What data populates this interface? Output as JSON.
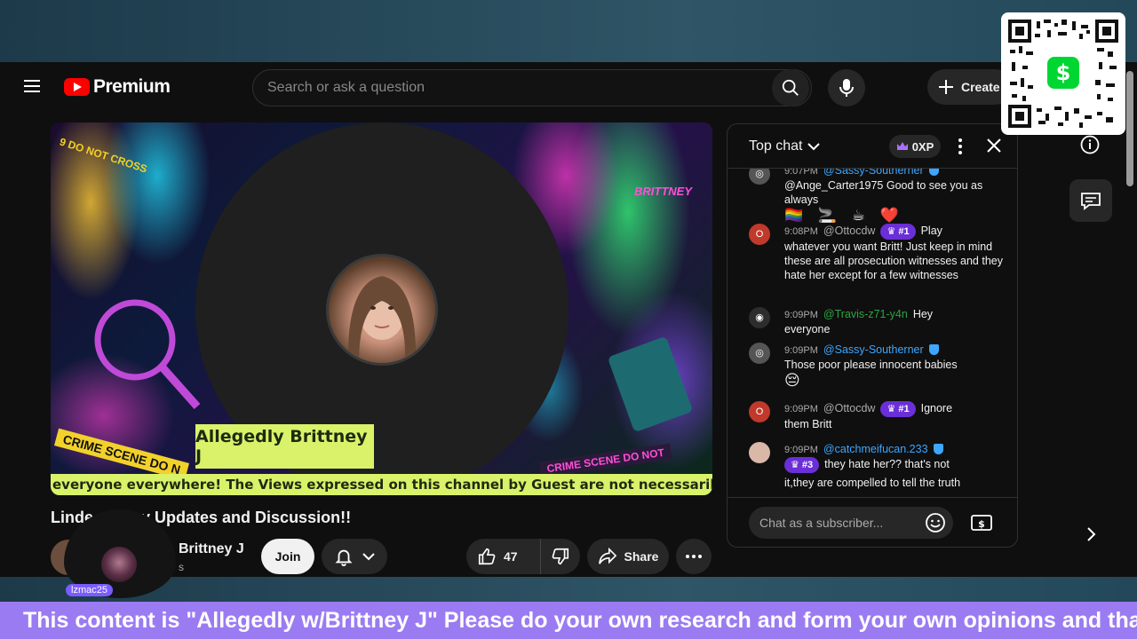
{
  "app": {
    "logo_text": "Premium",
    "search_placeholder": "Search or ask a question",
    "create_label": "Create"
  },
  "video": {
    "overlay_name": "Allegedly Brittney J",
    "ticker_text": "everyone everywhere! The Views expressed on this channel by Guest are not necessarily the views o",
    "brand_tag": "BRITTNEY",
    "tape_top": "9 DO NOT CROSS",
    "tape_bottom_left": "CRIME SCENE DO N",
    "tape_bottom_right": "CRIME SCENE DO NOT"
  },
  "watch": {
    "title": "Linda McNancy Updates and Discussion!!",
    "title_visible": "Linde",
    "title_tail": "cy Updates and Discussion!!",
    "channel_name": "Brittney J",
    "channel_subs": "s",
    "join_label": "Join",
    "like_count": "47",
    "share_label": "Share"
  },
  "overlay_cam": {
    "username": "lzmac25"
  },
  "chat": {
    "title": "Top chat",
    "xp": "0XP",
    "input_placeholder": "Chat as a subscriber...",
    "messages": [
      {
        "time": "9:07PM",
        "author": "@Sassy-Southerner",
        "text": "@Ange_Carter1975 Good to see you as always",
        "emoji": "🏳️‍🌈 🚬 ☕ ❤️"
      },
      {
        "time": "9:08PM",
        "author": "@Ottocdw",
        "rank": "#1",
        "lead": "Play",
        "text": "whatever you want Britt! Just keep in mind these are all prosecution witnesses and they hate her except for a few witnesses",
        "avatar_letter": "O"
      },
      {
        "time": "9:09PM",
        "author": "@Travis-z71-y4n",
        "lead": "Hey",
        "text": "everyone"
      },
      {
        "time": "9:09PM",
        "author": "@Sassy-Southerner",
        "text": "Those poor please innocent babies",
        "emoji": "😔"
      },
      {
        "time": "9:09PM",
        "author": "@Ottocdw",
        "rank": "#1",
        "lead": "Ignore",
        "text": "them Britt",
        "avatar_letter": "O"
      },
      {
        "time": "9:09PM",
        "author": "@catchmeifucan.233",
        "rank": "#3",
        "lead": "they hate her?? that's not",
        "text": "it,they are compelled to tell the truth"
      }
    ]
  },
  "banner": {
    "marquee_text": "This content is \"Allegedly w/Brittney J\" Please do your own research and form your own opinions and tha"
  },
  "colors": {
    "youtube_red": "#ff0000",
    "accent_lime": "#d9f26a",
    "rank_purple": "#6a2fd6",
    "marquee_purple": "#9b7bf2",
    "link_blue": "#3ea6ff",
    "cashapp_green": "#00d632"
  },
  "icons": [
    "menu-icon",
    "search-icon",
    "mic-icon",
    "plus-icon",
    "bell-icon",
    "chevron-down-icon",
    "thumb-up-icon",
    "thumb-down-icon",
    "share-icon",
    "more-icon",
    "close-icon",
    "info-icon",
    "chat-icon",
    "emoji-icon",
    "superchat-icon",
    "chevron-right-icon",
    "crown-icon",
    "qr-code",
    "dollar-icon"
  ]
}
